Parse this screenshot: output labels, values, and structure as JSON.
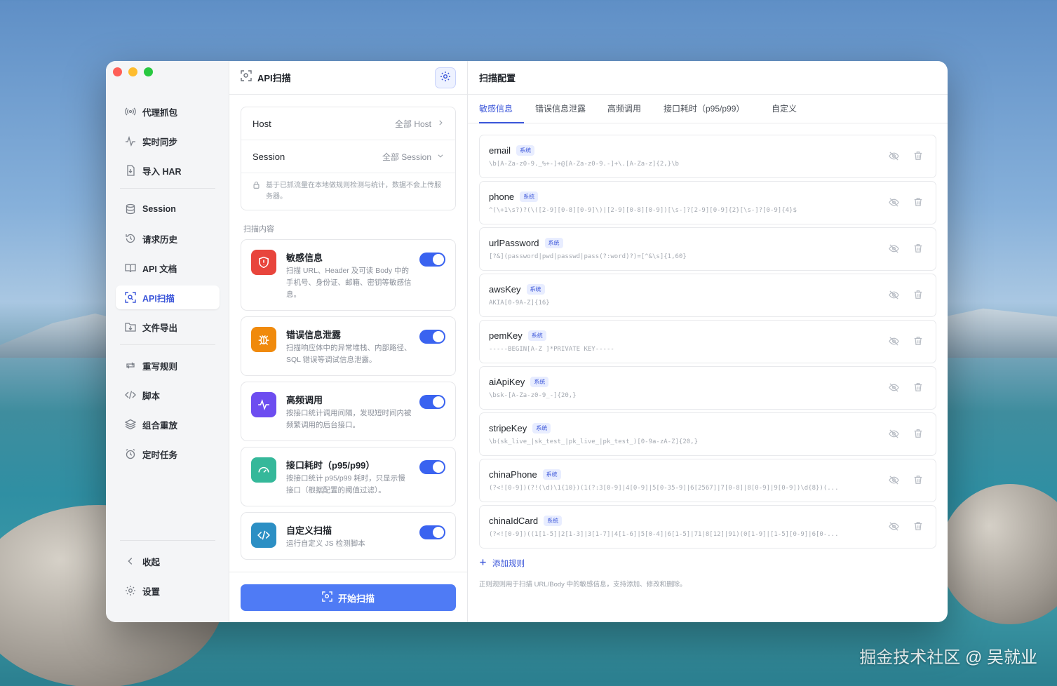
{
  "sidebar": {
    "items": [
      {
        "label": "代理抓包",
        "icon": "broadcast-icon"
      },
      {
        "label": "实时同步",
        "icon": "pulse-icon"
      },
      {
        "label": "导入 HAR",
        "icon": "import-file-icon"
      },
      {
        "label": "Session",
        "icon": "database-icon"
      },
      {
        "label": "请求历史",
        "icon": "history-icon"
      },
      {
        "label": "API 文档",
        "icon": "book-icon"
      },
      {
        "label": "API扫描",
        "icon": "scan-icon",
        "active": true
      },
      {
        "label": "文件导出",
        "icon": "export-icon"
      },
      {
        "label": "重写规则",
        "icon": "repeat-icon"
      },
      {
        "label": "脚本",
        "icon": "code-icon"
      },
      {
        "label": "组合重放",
        "icon": "layers-icon"
      },
      {
        "label": "定时任务",
        "icon": "alarm-icon"
      }
    ],
    "collapse_label": "收起",
    "settings_label": "设置"
  },
  "middle": {
    "title": "API扫描",
    "host_label": "Host",
    "host_value": "全部 Host",
    "session_label": "Session",
    "session_value": "全部 Session",
    "note": "基于已抓流量在本地做规则检测与统计，数据不会上传服务器。",
    "section_label": "扫描内容",
    "cards": [
      {
        "title": "敏感信息",
        "desc": "扫描 URL、Header 及可读 Body 中的手机号、身份证、邮箱、密钥等敏感信息。",
        "color": "#e8453c",
        "icon": "shield-icon",
        "enabled": true
      },
      {
        "title": "错误信息泄露",
        "desc": "扫描响应体中的异常堆栈、内部路径、SQL 错误等调试信息泄露。",
        "color": "#f08a0c",
        "icon": "bug-icon",
        "enabled": true
      },
      {
        "title": "高频调用",
        "desc": "按接口统计调用间隔，发现短时间内被频繁调用的后台接口。",
        "color": "#6d4df0",
        "icon": "activity-icon",
        "enabled": true
      },
      {
        "title": "接口耗时（p95/p99）",
        "desc": "按接口统计 p95/p99 耗时，只显示慢接口（根据配置的阈值过滤）。",
        "color": "#35b89a",
        "icon": "gauge-icon",
        "enabled": true
      },
      {
        "title": "自定义扫描",
        "desc": "运行自定义 JS 检测脚本",
        "color": "#2c8fc4",
        "icon": "code-icon",
        "enabled": true
      }
    ],
    "start_label": "开始扫描"
  },
  "right": {
    "title": "扫描配置",
    "tabs": [
      "敏感信息",
      "错误信息泄露",
      "高频调用",
      "接口耗时（p95/p99）",
      "自定义"
    ],
    "badge": "系统",
    "rules": [
      {
        "name": "email",
        "pattern": "\\b[A-Za-z0-9._%+-]+@[A-Za-z0-9.-]+\\.[A-Za-z]{2,}\\b"
      },
      {
        "name": "phone",
        "pattern": "^(\\+1\\s?)?(\\([2-9][0-8][0-9]\\)|[2-9][0-8][0-9])[\\s-]?[2-9][0-9]{2}[\\s-]?[0-9]{4}$"
      },
      {
        "name": "urlPassword",
        "pattern": "[?&](password|pwd|passwd|pass(?:word)?)=[^&\\s]{1,60}"
      },
      {
        "name": "awsKey",
        "pattern": "AKIA[0-9A-Z]{16}"
      },
      {
        "name": "pemKey",
        "pattern": "-----BEGIN[A-Z ]*PRIVATE KEY-----"
      },
      {
        "name": "aiApiKey",
        "pattern": "\\bsk-[A-Za-z0-9_-]{20,}"
      },
      {
        "name": "stripeKey",
        "pattern": "\\b(sk_live_|sk_test_|pk_live_|pk_test_)[0-9a-zA-Z]{20,}"
      },
      {
        "name": "chinaPhone",
        "pattern": "(?<![0-9])(?!(\\d)\\1{10})(1(?:3[0-9]|4[0-9]|5[0-35-9]|6[2567]|7[0-8]|8[0-9]|9[0-9])\\d{8})(..."
      },
      {
        "name": "chinaIdCard",
        "pattern": "(?<![0-9])((1[1-5]|2[1-3]|3[1-7]|4[1-6]|5[0-4]|6[1-5]|71|8[12]|91)(0[1-9]|[1-5][0-9]|6[0-..."
      }
    ],
    "add_label": "添加规则",
    "note": "正则规则用于扫描 URL/Body 中的敏感信息，支持添加、修改和删除。"
  },
  "watermark": "掘金技术社区 @ 吴就业"
}
